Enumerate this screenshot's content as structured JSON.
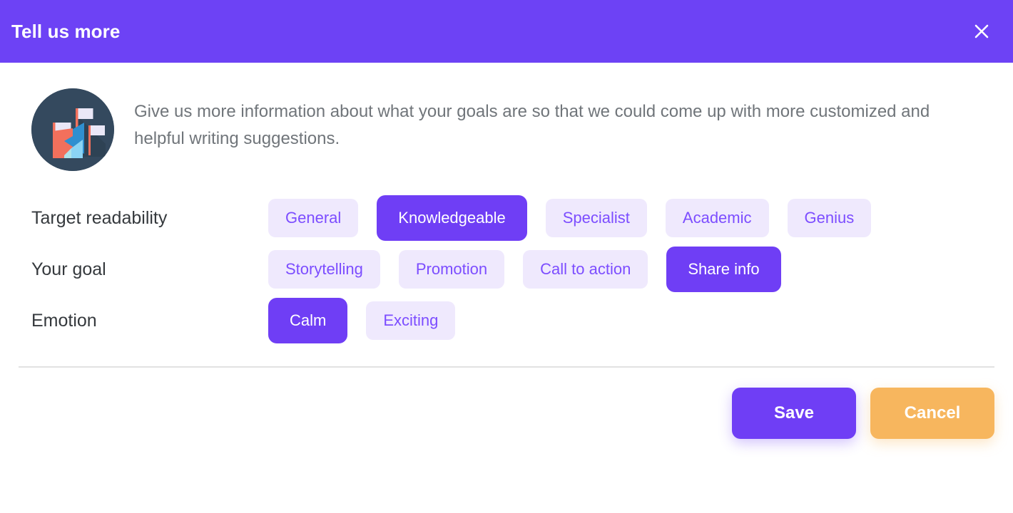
{
  "header": {
    "title": "Tell us more",
    "close_icon": "close-icon",
    "background_color": "#6d42f5"
  },
  "intro": {
    "avatar_icon": "mountain-flags-illustration",
    "description": "Give us more information about what your goals are so that we could come up with more customized and helpful writing suggestions."
  },
  "options": [
    {
      "label": "Target readability",
      "name": "target-readability",
      "choices": [
        {
          "label": "General",
          "selected": false
        },
        {
          "label": "Knowledgeable",
          "selected": true
        },
        {
          "label": "Specialist",
          "selected": false
        },
        {
          "label": "Academic",
          "selected": false
        },
        {
          "label": "Genius",
          "selected": false
        }
      ]
    },
    {
      "label": "Your goal",
      "name": "your-goal",
      "choices": [
        {
          "label": "Storytelling",
          "selected": false
        },
        {
          "label": "Promotion",
          "selected": false
        },
        {
          "label": "Call to action",
          "selected": false
        },
        {
          "label": "Share info",
          "selected": true
        }
      ]
    },
    {
      "label": "Emotion",
      "name": "emotion",
      "choices": [
        {
          "label": "Calm",
          "selected": true
        },
        {
          "label": "Exciting",
          "selected": false
        }
      ]
    }
  ],
  "footer": {
    "save_label": "Save",
    "cancel_label": "Cancel"
  },
  "colors": {
    "accent": "#6f3ef5",
    "pill_unselected_bg": "#efe9fd",
    "pill_unselected_text": "#7c4dff",
    "cancel": "#f7b65e",
    "body_text": "#70757a",
    "label_text": "#35393d"
  }
}
